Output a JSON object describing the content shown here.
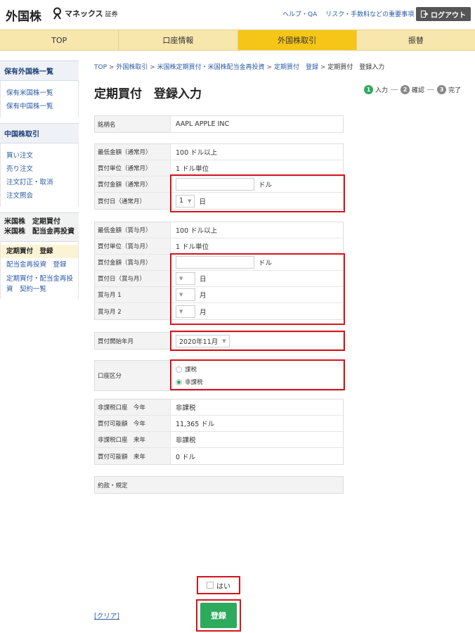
{
  "header": {
    "logo_title": "外国株",
    "brand_name": "マネックス",
    "brand_sub": "証券",
    "links": [
      "ヘルプ・QA",
      "リスク・手数料などの重要事項"
    ],
    "logout_label": "ログアウト"
  },
  "nav": {
    "tabs": [
      {
        "label": "TOP"
      },
      {
        "label": "口座情報"
      },
      {
        "label": "外国株取引"
      },
      {
        "label": "振替"
      }
    ]
  },
  "sidebar": {
    "sec1_head": "保有外国株一覧",
    "sec1_items": [
      "保有米国株一覧",
      "保有中国株一覧"
    ],
    "sec2_head": "中国株取引",
    "sec2_items": [
      "買い注文",
      "売り注文",
      "注文訂正・取消",
      "注文照会"
    ],
    "sec3_head_line1": "米国株　定期買付",
    "sec3_head_line2": "米国株　配当金再投資",
    "sec3_current": "定期買付　登録",
    "sec3_items": [
      "配当金再投資　登録",
      "定期買付・配当金再投資　契約一覧"
    ]
  },
  "breadcrumb": {
    "items": [
      "TOP",
      "外国株取引",
      "米国株定期買付・米国株配当金再投資",
      "定期買付　登録",
      "定期買付　登録入力"
    ],
    "separator": ">"
  },
  "page_title": "定期買付　登録入力",
  "steps": [
    {
      "num": "1",
      "label": "入力"
    },
    {
      "num": "2",
      "label": "確認"
    },
    {
      "num": "3",
      "label": "完了"
    }
  ],
  "stock": {
    "label": "銘柄名",
    "value": "AAPL APPLE INC"
  },
  "regular": {
    "min_label": "最低金額（通常月）",
    "min_value": "100 ドル以上",
    "unit_label": "買付単位（通常月）",
    "unit_value": "1 ドル単位",
    "amount_label": "買付金額（通常月）",
    "amount_unit": "ドル",
    "day_label": "買付日（通常月）",
    "day_value": "1",
    "day_unit": "日"
  },
  "bonus": {
    "min_label": "最低金額（賞与月）",
    "min_value": "100 ドル以上",
    "unit_label": "買付単位（賞与月）",
    "unit_value": "1 ドル単位",
    "amount_label": "買付金額（賞与月）",
    "amount_unit": "ドル",
    "day_label": "買付日（賞与月）",
    "day_unit": "日",
    "month1_label": "賞与月 1",
    "month2_label": "賞与月 2",
    "month_unit": "月"
  },
  "start": {
    "label": "買付開始年月",
    "value": "2020年11月"
  },
  "account": {
    "label": "口座区分",
    "option1": "課税",
    "option2": "非課税",
    "selected": "非課税"
  },
  "nisa": {
    "rows": [
      {
        "label": "非課税口座　今年",
        "value": "非課税"
      },
      {
        "label": "買付可能額　今年",
        "value": "11,365 ドル"
      },
      {
        "label": "非課税口座　来年",
        "value": "非課税"
      },
      {
        "label": "買付可能額　来年",
        "value": "0 ドル"
      }
    ]
  },
  "terms": {
    "label": "約款・規定"
  },
  "agree": {
    "label": "はい"
  },
  "clear_label": "[クリア]",
  "submit_label": "登録"
}
